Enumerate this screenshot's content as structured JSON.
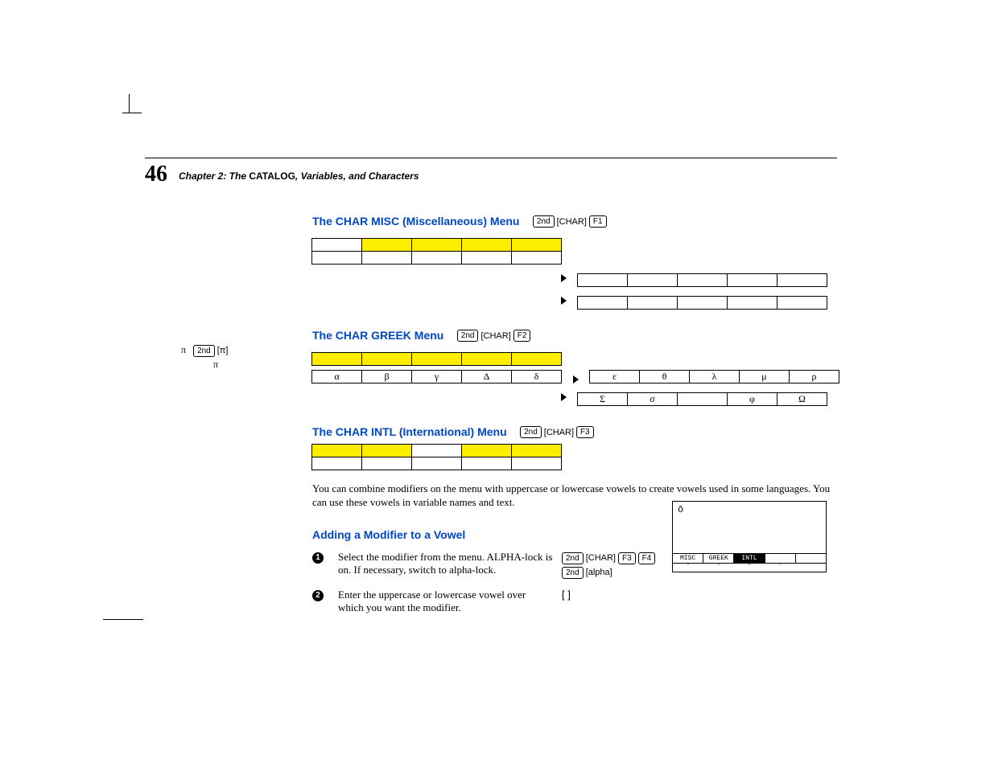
{
  "page_number": "46",
  "chapter_line": {
    "prefix_italic": "Chapter 2: The ",
    "catalog_bold": "CATALOG",
    "suffix_italic": ", Variables, and Characters"
  },
  "sections": {
    "misc": {
      "title": "The CHAR MISC (Miscellaneous) Menu",
      "keys": [
        "2nd",
        "[CHAR]",
        "F1"
      ]
    },
    "greek": {
      "title": "The CHAR GREEK Menu",
      "keys": [
        "2nd",
        "[CHAR]",
        "F2"
      ],
      "row2_left": [
        "α",
        "β",
        "γ",
        "Δ",
        "δ"
      ],
      "row2_right": [
        "ε",
        "θ",
        "λ",
        "μ",
        "ρ"
      ],
      "row3_right": [
        "Σ",
        "σ",
        "",
        "φ",
        "Ω"
      ]
    },
    "intl": {
      "title": "The CHAR INTL (International) Menu",
      "keys": [
        "2nd",
        "[CHAR]",
        "F3"
      ]
    },
    "modifier": {
      "title": "Adding a Modifier to a Vowel"
    }
  },
  "sidebar": {
    "l1_a": "π",
    "l1_keys": [
      "2nd",
      "[π]"
    ],
    "l2": "π"
  },
  "body_para": "You can combine modifiers on the                    menu with uppercase or lowercase vowels to create vowels used in some languages. You can use these vowels in variable names and text.",
  "steps": [
    {
      "n": "1",
      "text": "Select the modifier from the menu. ALPHA-lock is on. If necessary, switch to alpha-lock.",
      "keys_a": [
        "2nd",
        "[CHAR]",
        "F3",
        "F4"
      ],
      "keys_b": [
        "2nd",
        "[alpha]"
      ]
    },
    {
      "n": "2",
      "text": "Enter the uppercase or lowercase vowel over which you want the modifier.",
      "bracket": "[   ]"
    }
  ],
  "calc": {
    "display": "ō",
    "menu": [
      "MISC",
      "GREEK",
      "INTL",
      "",
      ""
    ],
    "menu_inv_index": 2,
    "sub": [
      "´",
      "`",
      "ˆ",
      "¨",
      ""
    ]
  }
}
